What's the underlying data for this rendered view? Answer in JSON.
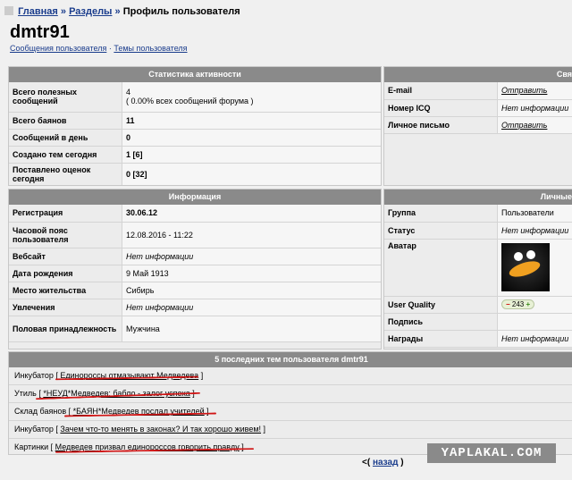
{
  "breadcrumb": {
    "home": "Главная",
    "sections": "Разделы",
    "current": "Профиль пользователя"
  },
  "user": {
    "name": "dmtr91",
    "link_posts": "Сообщения пользователя",
    "link_topics": "Темы пользователя"
  },
  "stats": {
    "title": "Статистика активности",
    "rows": [
      {
        "label": "Всего полезных сообщений",
        "value": "4",
        "sub": "( 0.00% всех сообщений форума )"
      },
      {
        "label": "Всего баянов",
        "value": "11"
      },
      {
        "label": "Сообщений в день",
        "value": "0"
      },
      {
        "label": "Создано тем сегодня",
        "value": "1 [6]"
      },
      {
        "label": "Поставлено оценок сегодня",
        "value": "0 [32]"
      }
    ]
  },
  "contacts": {
    "title": "Свя",
    "rows": [
      {
        "label": "E-mail",
        "value": "Отправить"
      },
      {
        "label": "Номер ICQ",
        "value": "Нет информации"
      },
      {
        "label": "Личное письмо",
        "value": "Отправить"
      }
    ]
  },
  "info": {
    "title": "Информация",
    "rows": [
      {
        "label": "Регистрация",
        "value": "30.06.12"
      },
      {
        "label": "Часовой пояс пользователя",
        "value": "12.08.2016 - 11:22"
      },
      {
        "label": "Вебсайт",
        "value": "Нет информации"
      },
      {
        "label": "Дата рождения",
        "value": "9 Май 1913"
      },
      {
        "label": "Место жительства",
        "value": "Сибирь"
      },
      {
        "label": "Увлечения",
        "value": "Нет информации"
      },
      {
        "label": "Половая принадлежность",
        "value": "Мужчина"
      }
    ]
  },
  "personal": {
    "title": "Личные",
    "rows": [
      {
        "label": "Группа",
        "value": "Пользователи"
      },
      {
        "label": "Статус",
        "value": "Нет информации"
      },
      {
        "label": "Аватар",
        "value": ""
      },
      {
        "label": "User Quality",
        "value": "243"
      },
      {
        "label": "Подпись",
        "value": ""
      },
      {
        "label": "Награды",
        "value": "Нет информации"
      }
    ]
  },
  "recent": {
    "title": "5 последних тем пользователя dmtr91",
    "items": [
      {
        "section": "Инкубатор",
        "topic": "Единороссы отмазывают Медведева"
      },
      {
        "section": "Утиль",
        "topic": "*НЕУД*Медведев: бабло - залог успеха"
      },
      {
        "section": "Склад баянов",
        "topic": "*БАЯН*Медведев послал учителей"
      },
      {
        "section": "Инкубатор",
        "topic": "Зачем что-то менять в законах? И так хорошо живем!"
      },
      {
        "section": "Картинки",
        "topic": "Медведев призвал единороссов говорить правду"
      }
    ]
  },
  "back": {
    "prefix": "<(",
    "link": "назад",
    "suffix": ")"
  },
  "watermark": "YAPLAKAL.COM",
  "colors": {
    "link": "#1a3c8c",
    "header": "#8a8a8a",
    "annotation": "#d01515"
  }
}
